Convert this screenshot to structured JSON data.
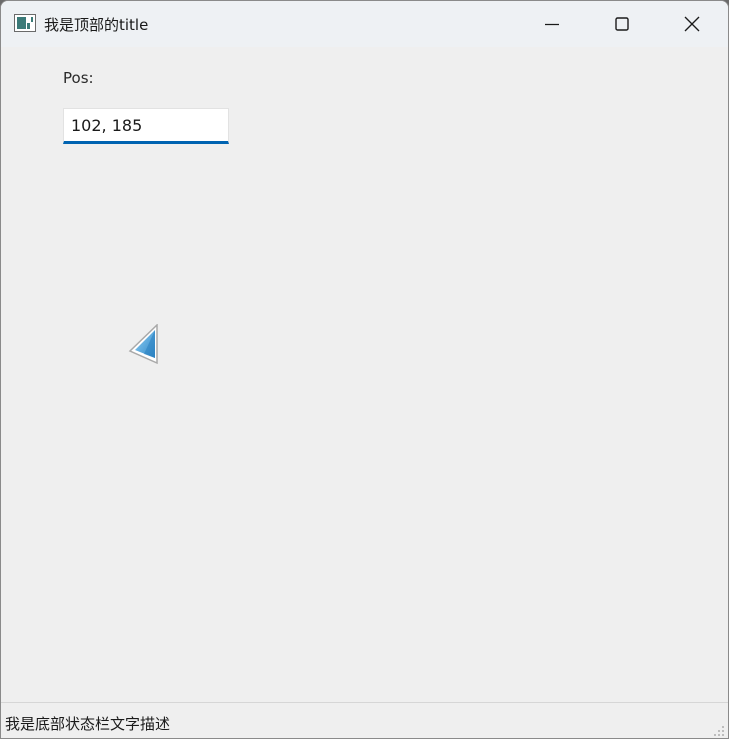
{
  "window": {
    "title": "我是顶部的title",
    "app_icon": "app-window-icon",
    "controls": {
      "minimize_icon": "minimize-icon",
      "maximize_icon": "maximize-icon",
      "close_icon": "close-icon"
    }
  },
  "main": {
    "pos_label": "Pos:",
    "pos_value": "102, 185",
    "cursor_icon": "arrow-cursor-icon"
  },
  "statusbar": {
    "text": "我是底部状态栏文字描述",
    "grip_icon": "resize-grip-icon"
  },
  "colors": {
    "accent": "#0063b1",
    "titlebar_bg": "#eef1f4",
    "content_bg": "#efefef",
    "cursor_fill": "#4a9fd8"
  }
}
